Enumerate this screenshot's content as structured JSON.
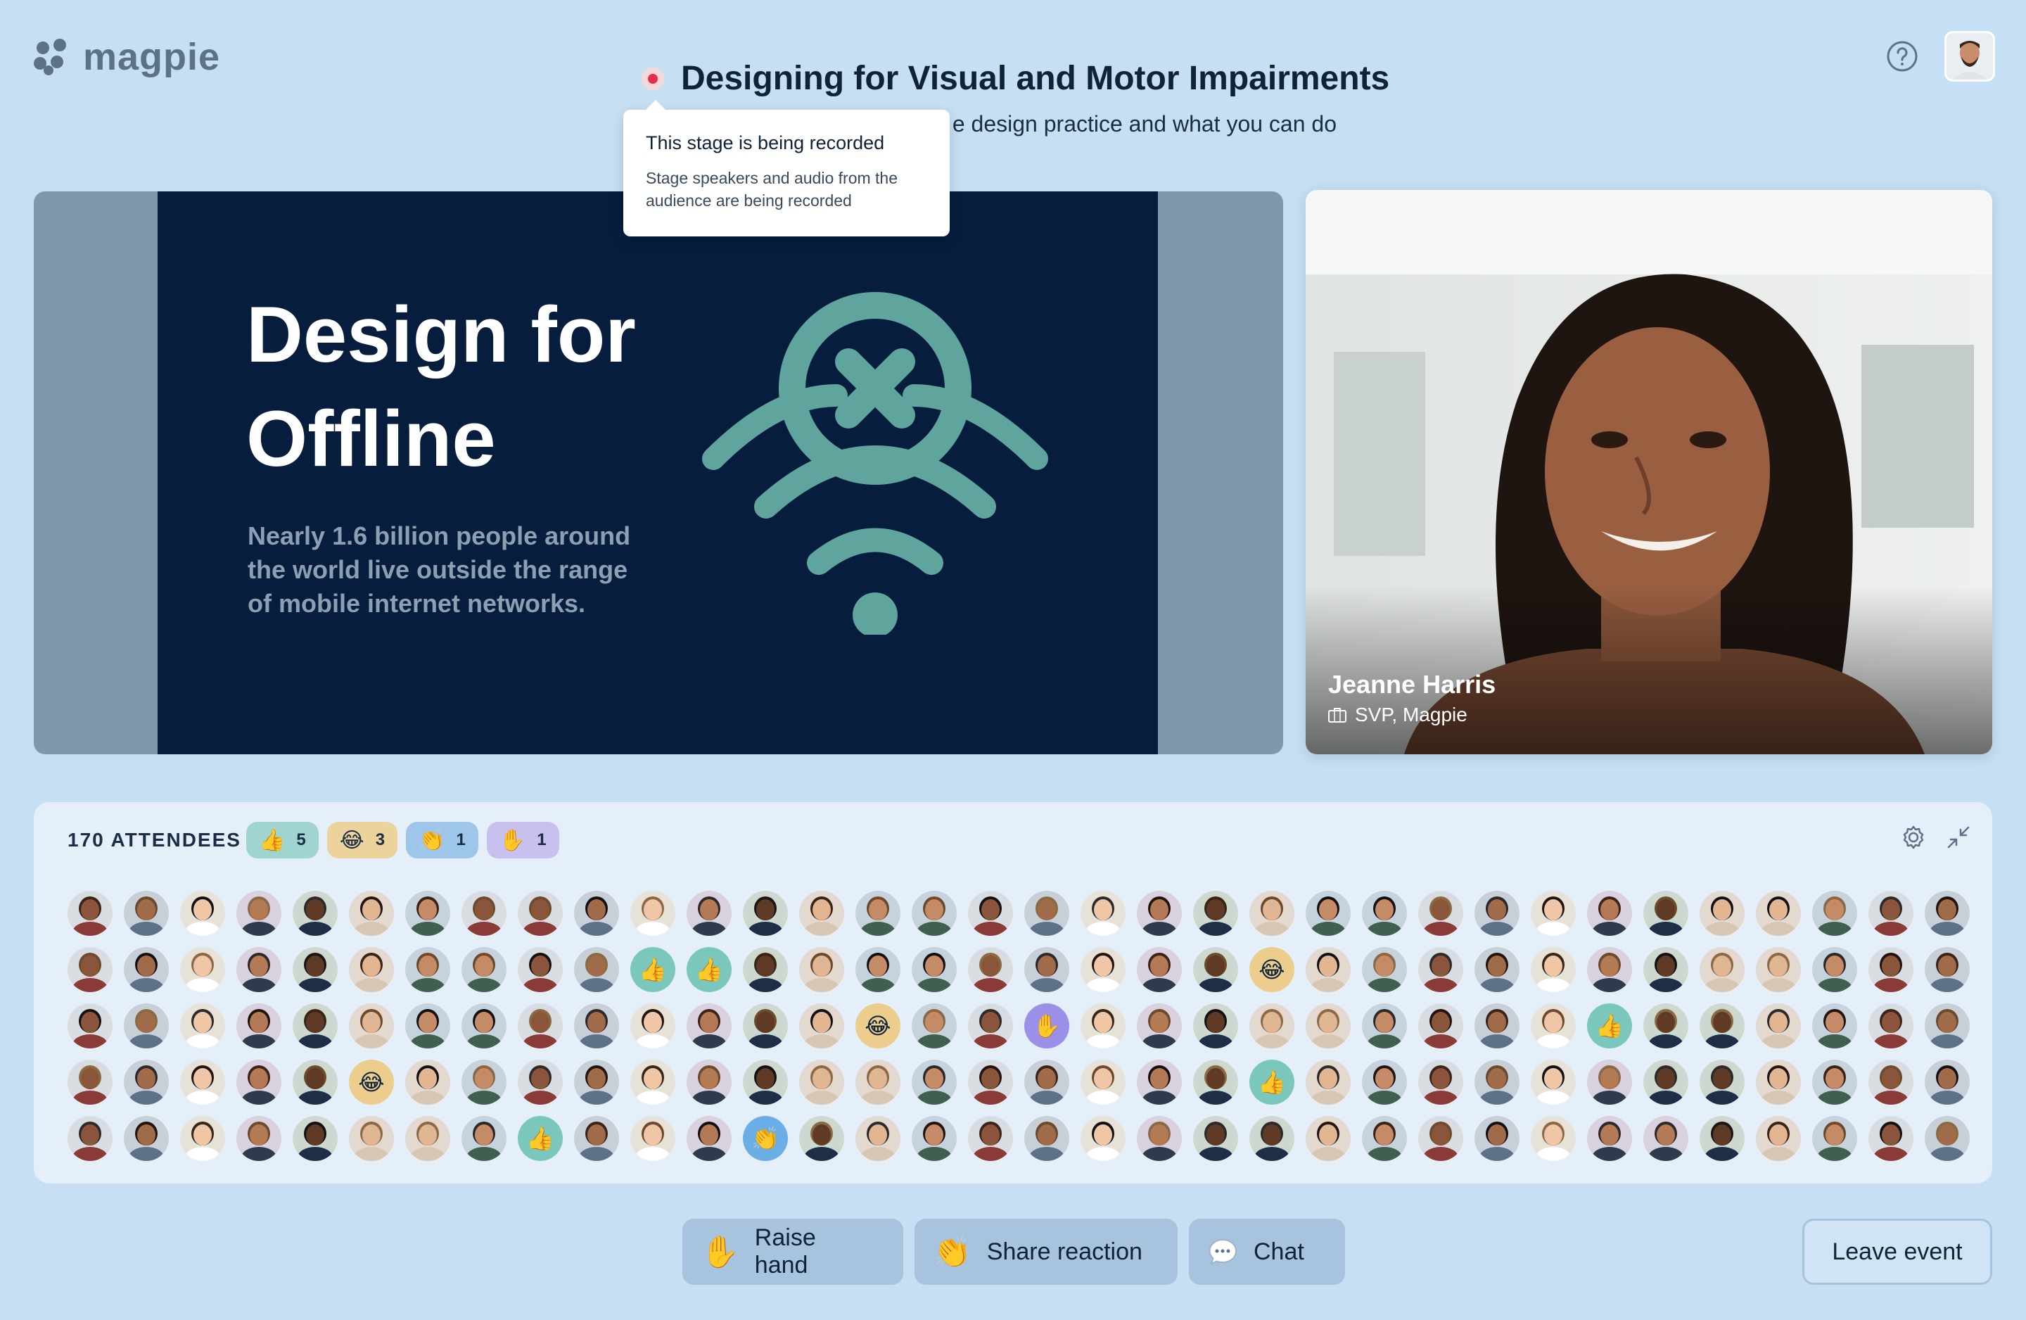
{
  "app": {
    "name": "magpie"
  },
  "header": {
    "title": "Designing for Visual and Motor Impairments",
    "subtitle": "e design practice and what you can do"
  },
  "tooltip": {
    "title": "This stage is being recorded",
    "body": "Stage speakers and audio from the audience are being recorded"
  },
  "slide": {
    "heading": "Design for Offline",
    "body": "Nearly 1.6 billion people around the world live outside the range of mobile internet networks."
  },
  "speaker": {
    "name": "Jeanne Harris",
    "role": "SVP, Magpie"
  },
  "attendees": {
    "count_label": "170 ATTENDEES",
    "reactions": [
      {
        "emoji": "👍",
        "count": "5",
        "color": "#9fd4cf"
      },
      {
        "emoji": "😂",
        "count": "3",
        "color": "#ecd39c"
      },
      {
        "emoji": "👏",
        "count": "1",
        "color": "#9dc6ea"
      },
      {
        "emoji": "✋",
        "count": "1",
        "color": "#c8c1f0"
      }
    ],
    "rows": 5,
    "cols": 34,
    "reaction_cells": [
      {
        "row": 1,
        "col": 10,
        "emoji": "👍",
        "color": "#7cc7bd"
      },
      {
        "row": 1,
        "col": 11,
        "emoji": "👍",
        "color": "#7cc7bd"
      },
      {
        "row": 1,
        "col": 21,
        "emoji": "😂",
        "color": "#eccd8d"
      },
      {
        "row": 2,
        "col": 14,
        "emoji": "😂",
        "color": "#eccd8d"
      },
      {
        "row": 2,
        "col": 17,
        "emoji": "✋",
        "color": "#9b8fe8"
      },
      {
        "row": 2,
        "col": 27,
        "emoji": "👍",
        "color": "#7cc7bd"
      },
      {
        "row": 3,
        "col": 5,
        "emoji": "😂",
        "color": "#eccd8d"
      },
      {
        "row": 3,
        "col": 21,
        "emoji": "👍",
        "color": "#7cc7bd"
      },
      {
        "row": 4,
        "col": 8,
        "emoji": "👍",
        "color": "#7cc7bd"
      },
      {
        "row": 4,
        "col": 12,
        "emoji": "👏",
        "color": "#6aaee6"
      }
    ]
  },
  "actions": {
    "raise_hand": {
      "emoji": "✋",
      "label": "Raise hand"
    },
    "share_reaction": {
      "emoji": "👏",
      "label": "Share reaction"
    },
    "chat": {
      "label": "Chat"
    },
    "leave": {
      "label": "Leave event"
    }
  },
  "icons": {
    "help": "help-icon",
    "gear": "gear-icon",
    "collapse": "collapse-icon",
    "chat": "chat-icon",
    "briefcase": "briefcase-icon"
  },
  "colors": {
    "background": "#c6dff3",
    "slide_bg": "#061d3d",
    "slide_accent": "#5fa59d",
    "recording": "#e0314b"
  }
}
